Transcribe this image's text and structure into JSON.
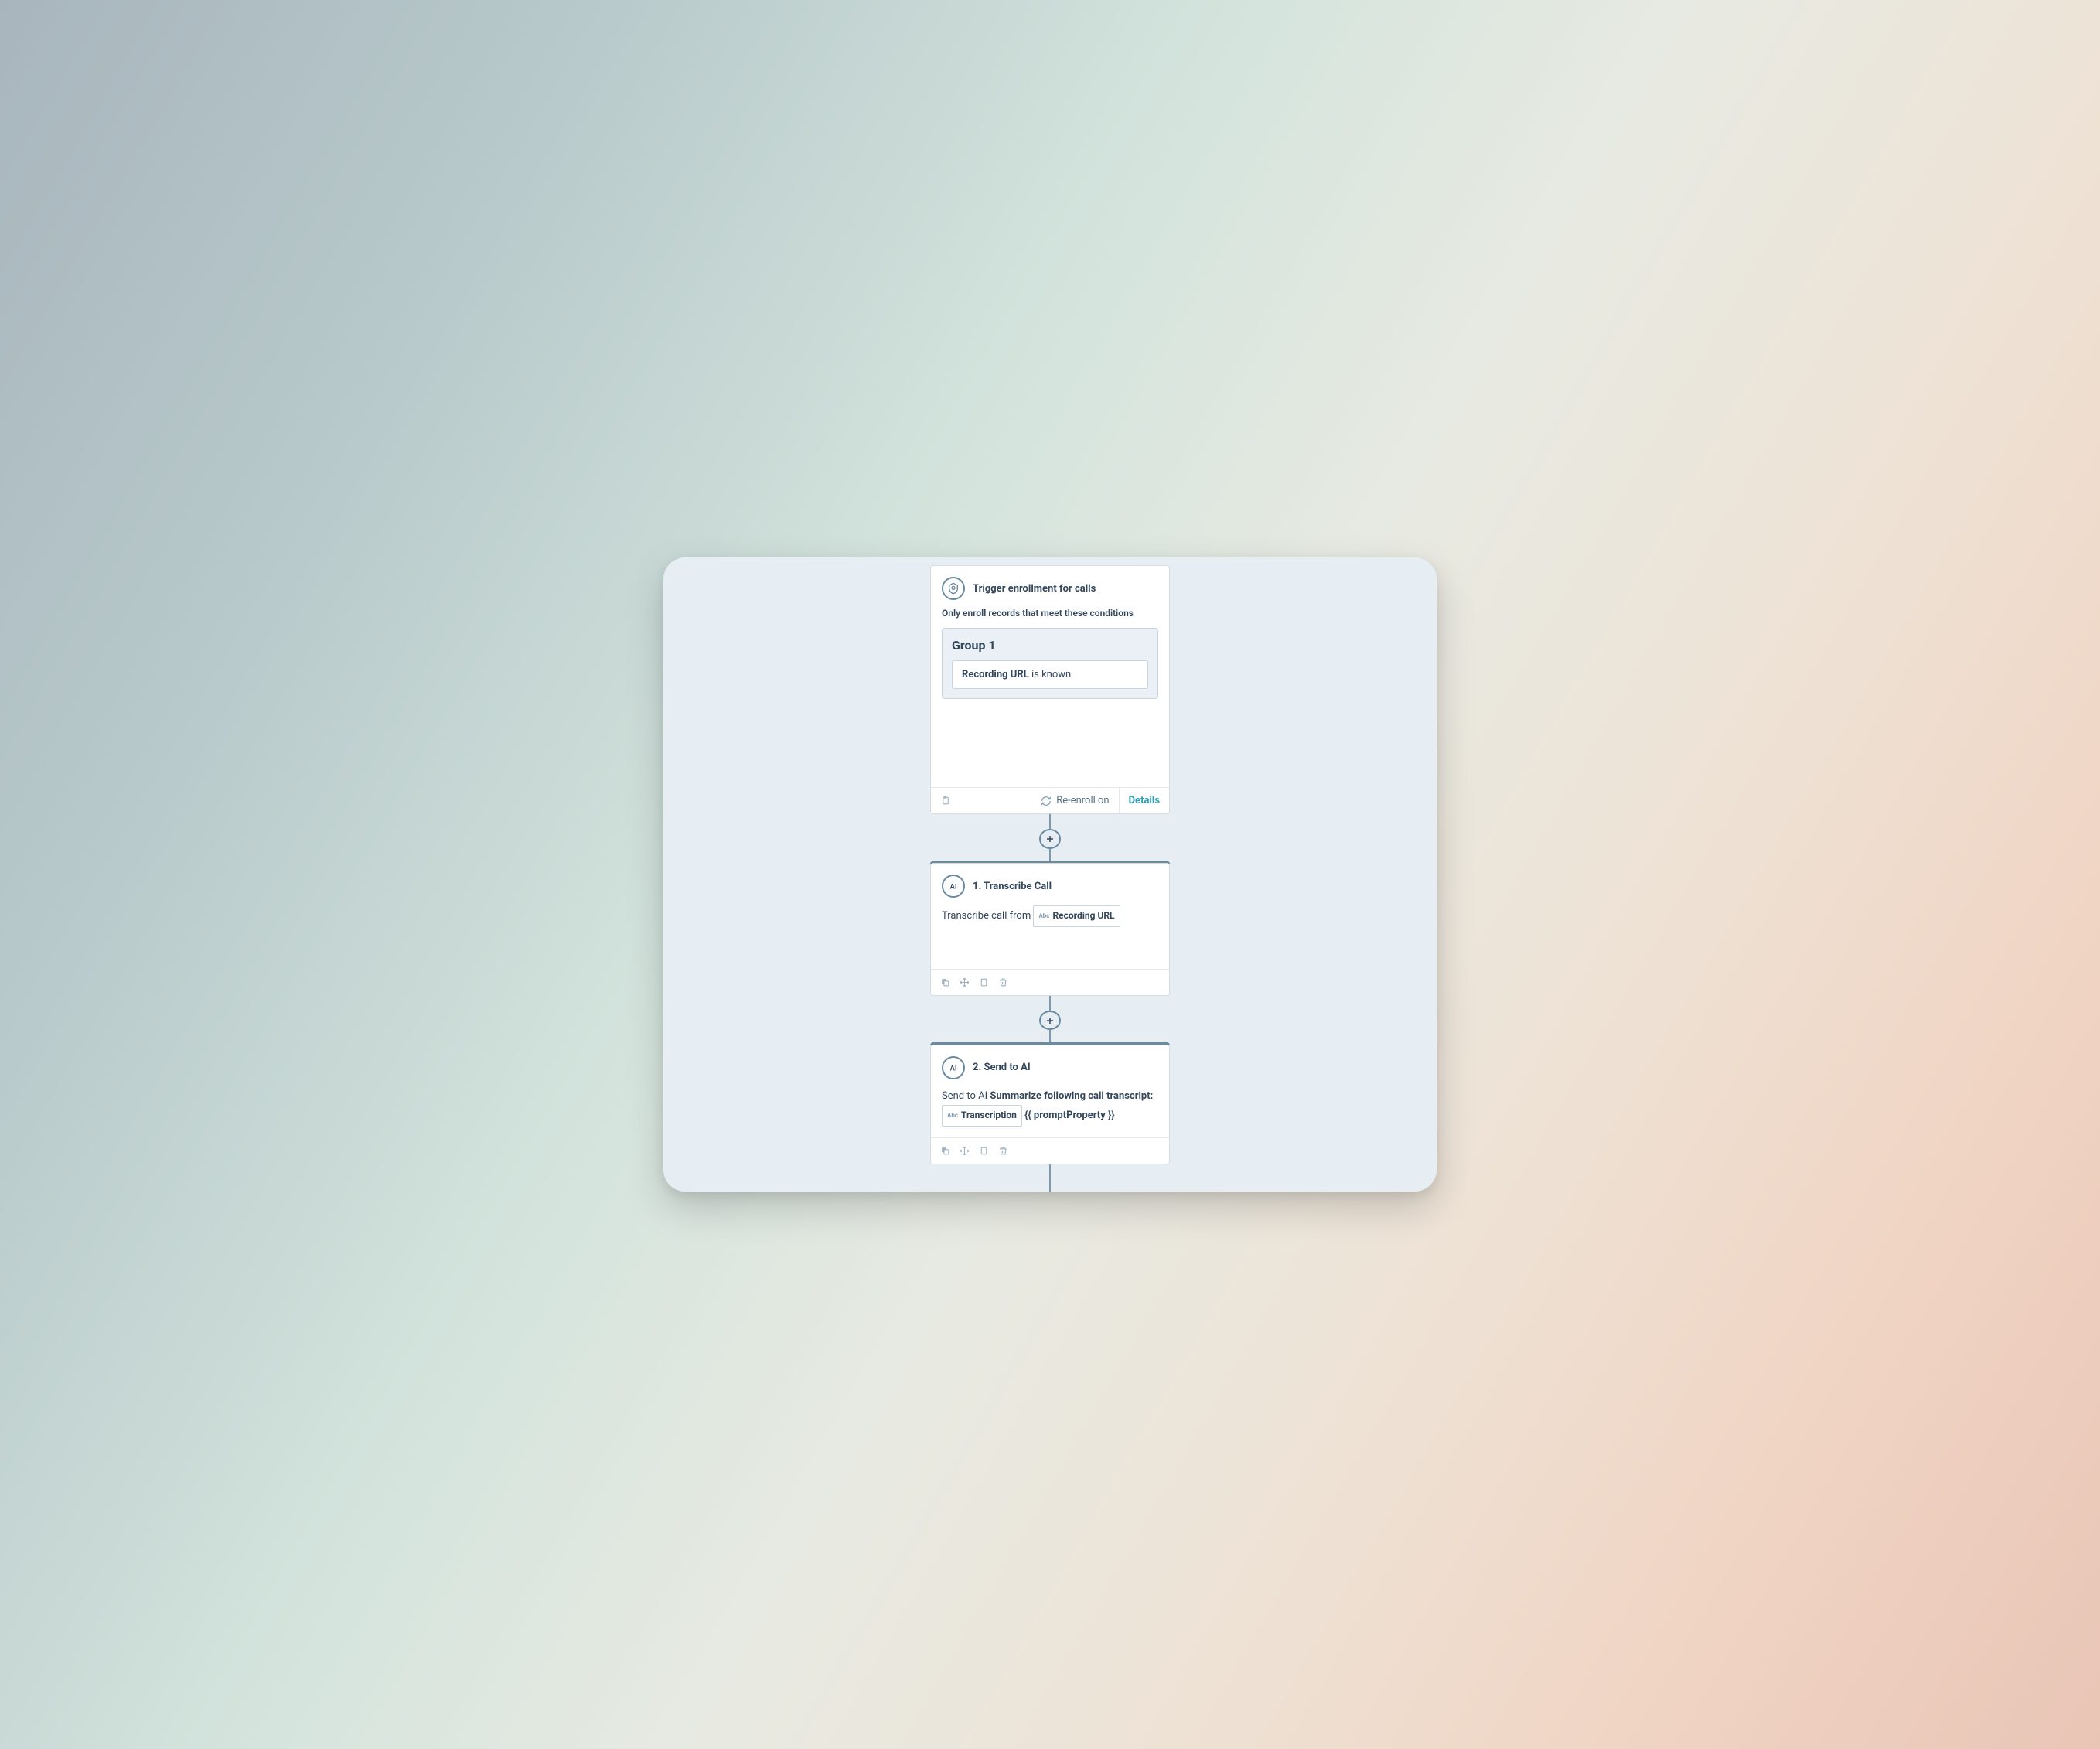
{
  "trigger": {
    "title": "Trigger enrollment for calls",
    "subtitle": "Only enroll records that meet these conditions",
    "group_label": "Group 1",
    "filter_property": "Recording URL",
    "filter_operator": "is known",
    "reenroll_label": "Re-enroll on",
    "details_label": "Details"
  },
  "step1": {
    "title": "1. Transcribe Call",
    "prefix": "Transcribe call from",
    "token_type": "Abc",
    "token_label": "Recording URL"
  },
  "step2": {
    "title": "2. Send to AI",
    "prefix": "Send to AI",
    "bold_a": "Summarize following call transcript:",
    "token_type": "Abc",
    "token_label": "Transcription",
    "bold_b": "{{ promptProperty }}"
  },
  "icons": {
    "ai_label": "AI"
  }
}
